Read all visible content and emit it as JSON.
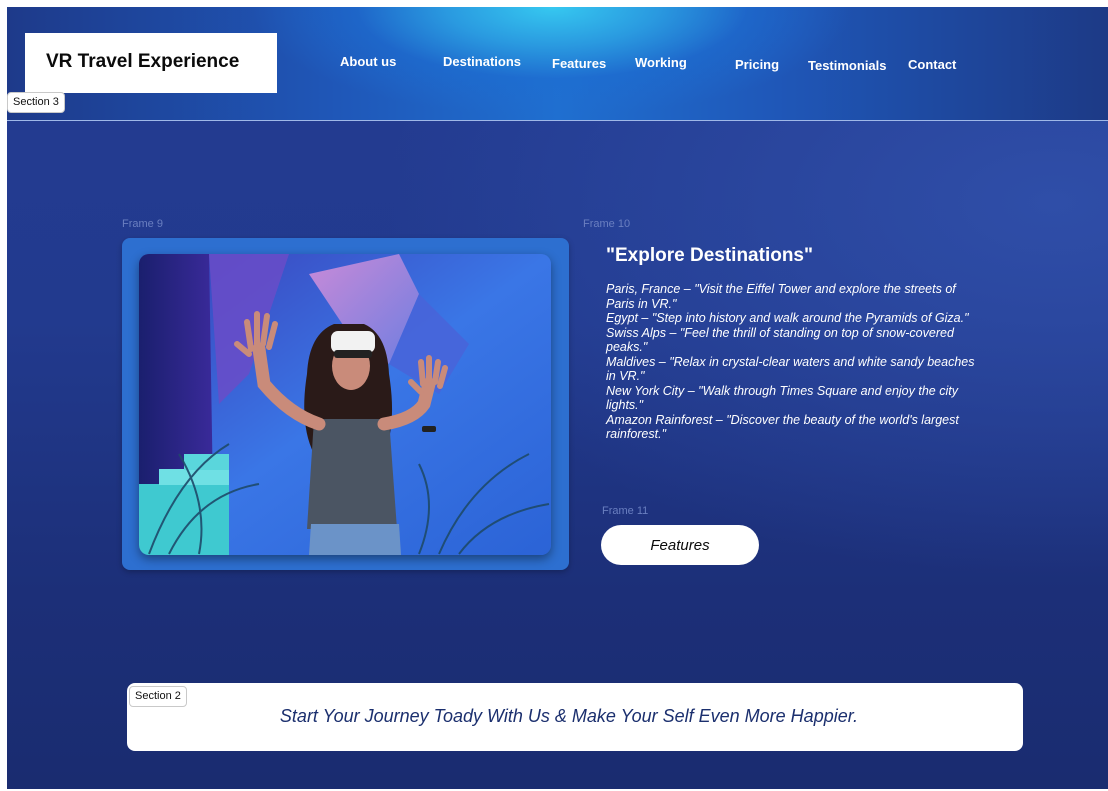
{
  "header": {
    "logo": "VR Travel Experience",
    "nav": [
      "About us",
      "Destinations",
      "Features",
      "Working",
      "Pricing",
      "Testimonials",
      "Contact"
    ]
  },
  "frame_tags": {
    "section3": "Section 3",
    "section2": "Section 2"
  },
  "frame_labels": {
    "frame9": "Frame 9",
    "frame10": "Frame 10",
    "frame11": "Frame 11"
  },
  "main": {
    "heading": "\"Explore Destinations\"",
    "destinations": [
      "Paris, France – \"Visit the Eiffel Tower and explore the streets of Paris in VR.\"",
      "Egypt – \"Step into history and walk around the Pyramids of Giza.\"",
      "Swiss Alps – \"Feel the thrill of standing on top of snow-covered peaks.\"",
      "Maldives – \"Relax in crystal-clear waters and white sandy beaches in VR.\"",
      "New York City – \"Walk through Times Square and enjoy the city lights.\"",
      "Amazon Rainforest – \"Discover the beauty of the world's largest rainforest.\""
    ],
    "button_label": "Features"
  },
  "cta": {
    "text": "Start Your Journey Toady With Us & Make Your Self Even More Happier."
  },
  "colors": {
    "background": "#223a8e",
    "header_glow": "#36c8f0",
    "card": "#2d6fd0",
    "cta_text": "#1b2f6e"
  }
}
